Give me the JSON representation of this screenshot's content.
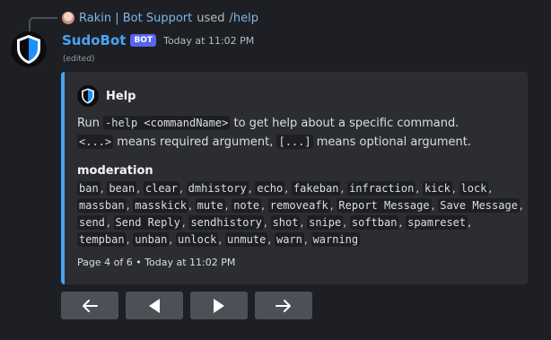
{
  "reply": {
    "user": "Rakin | Bot Support",
    "action": "used",
    "command": "/help"
  },
  "message": {
    "author": "SudoBot",
    "badge": "BOT",
    "timestamp": "Today at 11:02 PM",
    "edited": "(edited)"
  },
  "embed": {
    "accent_color": "#4ba4f1",
    "author_name": "Help",
    "desc_line1_pre": "Run ",
    "desc_line1_code": "-help <commandName>",
    "desc_line1_post": " to get help about a specific command.",
    "desc_line2_code1": "<...>",
    "desc_line2_mid": " means required argument, ",
    "desc_line2_code2": "[...]",
    "desc_line2_post": " means optional argument.",
    "field_name": "moderation",
    "commands": [
      "ban",
      "bean",
      "clear",
      "dmhistory",
      "echo",
      "fakeban",
      "infraction",
      "kick",
      "lock",
      "massban",
      "masskick",
      "mute",
      "note",
      "removeafk",
      "Report Message",
      "Save Message",
      "send",
      "Send Reply",
      "sendhistory",
      "shot",
      "snipe",
      "softban",
      "spamreset",
      "tempban",
      "unban",
      "unlock",
      "unmute",
      "warn",
      "warning"
    ],
    "footer": "Page 4 of 6 • Today at 11:02 PM"
  },
  "buttons": [
    {
      "name": "first-page-button",
      "icon": "arrow-left-icon"
    },
    {
      "name": "previous-page-button",
      "icon": "triangle-left-icon"
    },
    {
      "name": "next-page-button",
      "icon": "triangle-right-icon"
    },
    {
      "name": "last-page-button",
      "icon": "arrow-right-icon"
    }
  ]
}
